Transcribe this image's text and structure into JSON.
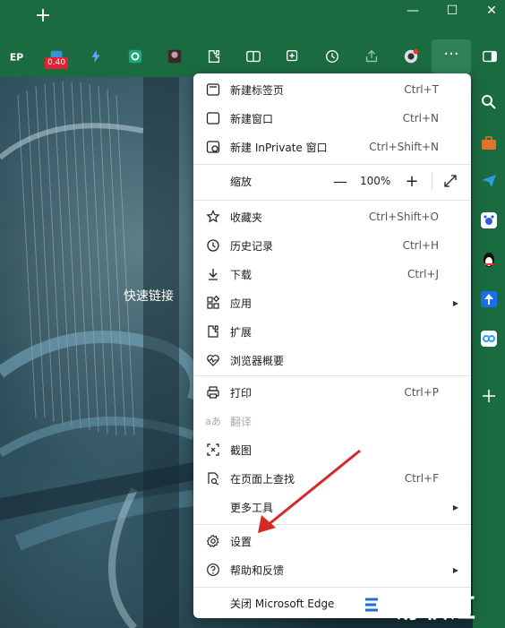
{
  "menu": {
    "items": [
      {
        "label": "新建标签页",
        "shortcut": "Ctrl+T"
      },
      {
        "label": "新建窗口",
        "shortcut": "Ctrl+N"
      },
      {
        "label": "新建 InPrivate 窗口",
        "shortcut": "Ctrl+Shift+N"
      },
      {
        "label": "缩放",
        "zoom": "100%"
      },
      {
        "label": "收藏夹",
        "shortcut": "Ctrl+Shift+O"
      },
      {
        "label": "历史记录",
        "shortcut": "Ctrl+H"
      },
      {
        "label": "下载",
        "shortcut": "Ctrl+J"
      },
      {
        "label": "应用",
        "submenu": true
      },
      {
        "label": "扩展"
      },
      {
        "label": "浏览器概要"
      },
      {
        "label": "打印",
        "shortcut": "Ctrl+P"
      },
      {
        "label": "翻译",
        "disabled": true
      },
      {
        "label": "截图"
      },
      {
        "label": "在页面上查找",
        "shortcut": "Ctrl+F"
      },
      {
        "label": "更多工具",
        "submenu": true
      },
      {
        "label": "设置"
      },
      {
        "label": "帮助和反馈",
        "submenu": true
      },
      {
        "label": "关闭 Microsoft Edge"
      }
    ],
    "zoom_minus": "—",
    "zoom_plus": "+"
  },
  "toolbar": {
    "badge": "0.40",
    "more": "···"
  },
  "page": {
    "quick_links": "快速链接"
  },
  "watermark": {
    "text": "易软汇"
  },
  "colors": {
    "chrome_green": "#1b6b40",
    "annotation_red": "#d62828"
  }
}
